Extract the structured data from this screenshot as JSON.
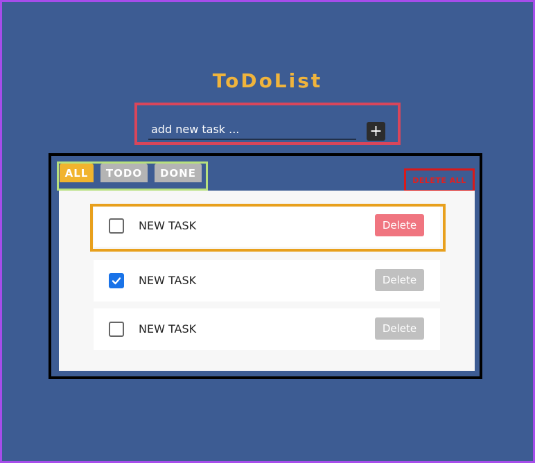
{
  "app": {
    "title": "ToDoList"
  },
  "input": {
    "placeholder": "add new task ...",
    "value": "",
    "add_button_label": "+"
  },
  "filters": {
    "tabs": [
      {
        "label": "ALL",
        "active": true
      },
      {
        "label": "TODO",
        "active": false
      },
      {
        "label": "DONE",
        "active": false
      }
    ]
  },
  "actions": {
    "delete_all_label": "DELETE ALL"
  },
  "tasks": [
    {
      "label": "NEW TASK",
      "checked": false,
      "delete_label": "Delete"
    },
    {
      "label": "NEW TASK",
      "checked": true,
      "delete_label": "Delete"
    },
    {
      "label": "NEW TASK",
      "checked": false,
      "delete_label": "Delete"
    }
  ],
  "colors": {
    "background": "#3d5c93",
    "title": "#f0b43c",
    "active_tab": "#f1b42e",
    "inactive_tab": "#b4b4b4",
    "delete_active": "#f07580",
    "delete_inactive": "#c0c0c0",
    "checkbox_checked": "#1a73e8"
  }
}
